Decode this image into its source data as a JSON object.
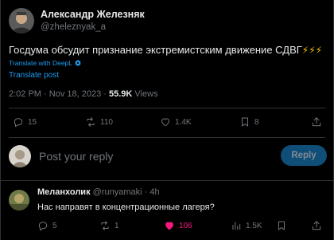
{
  "author": {
    "display_name": "Александр Железняк",
    "handle": "@zheleznyak_a"
  },
  "tweet": {
    "text": "Госдума обсудит признание экстремистским движение СДВГ",
    "emoji": "⚡⚡⚡",
    "translate_deepl": "Translate with DeepL",
    "translate_post": "Translate post"
  },
  "meta": {
    "time": "2:02 PM",
    "separator": "·",
    "date": "Nov 18, 2023",
    "views_count": "55.9K",
    "views_label": "Views"
  },
  "actions": {
    "replies": "15",
    "reposts": "110",
    "likes": "1.4K",
    "bookmarks": "8"
  },
  "reply_box": {
    "placeholder": "Post your reply",
    "button": "Reply"
  },
  "comment": {
    "display_name": "Меланхолик",
    "handle": "@runyamaki",
    "separator": "·",
    "age": "4h",
    "text": "Нас направят в концентрационные лагеря?",
    "replies": "5",
    "reposts": "1",
    "likes": "106",
    "views": "1.5K"
  },
  "colors": {
    "accent": "#1d9bf0",
    "liked": "#f91880",
    "muted": "#71767b"
  }
}
